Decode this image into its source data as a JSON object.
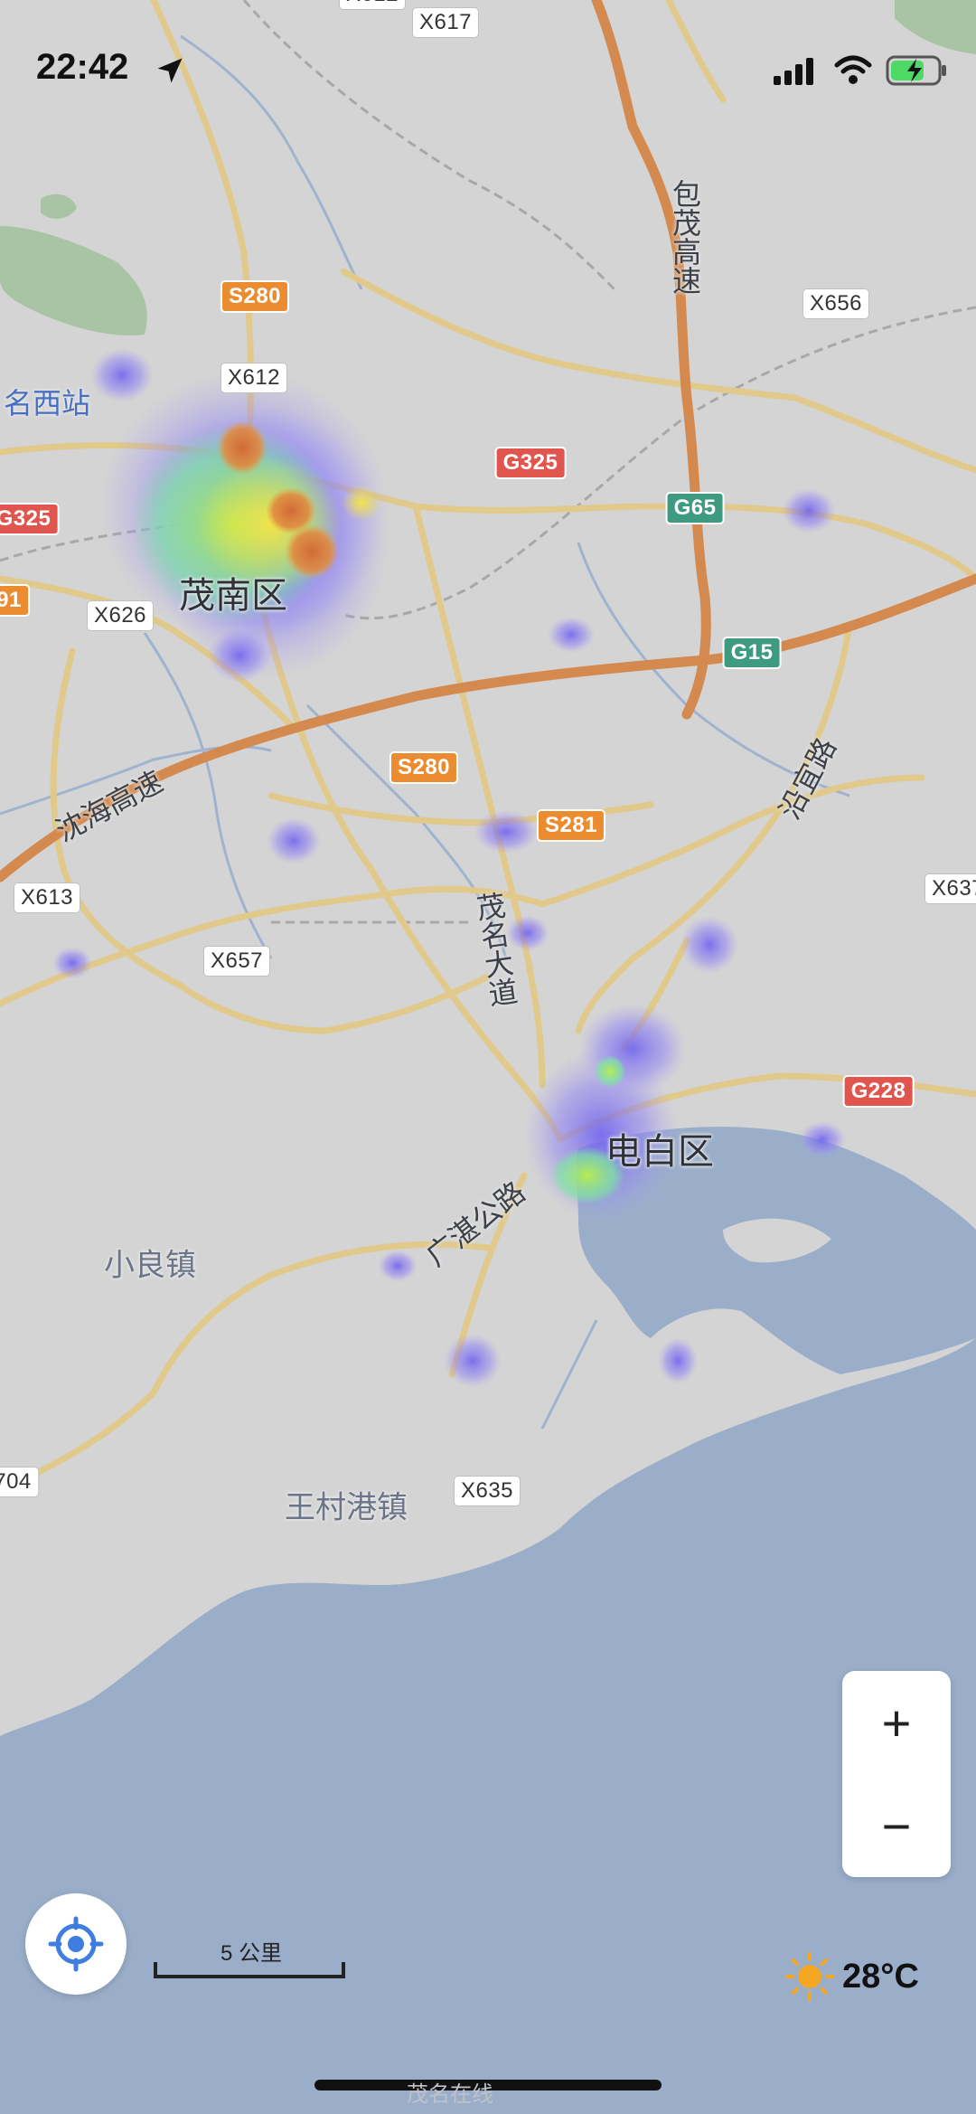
{
  "status_bar": {
    "time": "22:42"
  },
  "map": {
    "places": [
      {
        "id": "maonan",
        "text": "茂南区",
        "cls": "big"
      },
      {
        "id": "dianbai",
        "text": "电白区",
        "cls": "big"
      },
      {
        "id": "xiaoliang",
        "text": "小良镇",
        "cls": "light"
      },
      {
        "id": "wangcun",
        "text": "王村港镇",
        "cls": "light"
      },
      {
        "id": "station",
        "text": "名西站",
        "cls": "station"
      }
    ],
    "road_names": [
      {
        "id": "baomao",
        "text": "包茂高速"
      },
      {
        "id": "shenhai",
        "text": "沈海高速"
      },
      {
        "id": "maoming",
        "text": "茂名大道"
      },
      {
        "id": "guangzhan",
        "text": "广湛公路"
      },
      {
        "id": "yanyi",
        "text": "沿宜路"
      }
    ],
    "shields": [
      {
        "id": "x617",
        "text": "X617",
        "type": "county"
      },
      {
        "id": "x612top",
        "text": "X612",
        "type": "county"
      },
      {
        "id": "s280a",
        "text": "S280",
        "type": "provincial"
      },
      {
        "id": "x656",
        "text": "X656",
        "type": "county"
      },
      {
        "id": "x612",
        "text": "X612",
        "type": "county"
      },
      {
        "id": "g325a",
        "text": "G325",
        "type": "national"
      },
      {
        "id": "g325b",
        "text": "G325",
        "type": "national"
      },
      {
        "id": "g65",
        "text": "G65",
        "type": "expressway"
      },
      {
        "id": "s91",
        "text": "91",
        "type": "provincial"
      },
      {
        "id": "x626",
        "text": "X626",
        "type": "county"
      },
      {
        "id": "g15",
        "text": "G15",
        "type": "expressway"
      },
      {
        "id": "s280b",
        "text": "S280",
        "type": "provincial"
      },
      {
        "id": "s281",
        "text": "S281",
        "type": "provincial"
      },
      {
        "id": "x613",
        "text": "X613",
        "type": "county"
      },
      {
        "id": "x637",
        "text": "X637",
        "type": "county"
      },
      {
        "id": "x657",
        "text": "X657",
        "type": "county"
      },
      {
        "id": "g228",
        "text": "G228",
        "type": "national"
      },
      {
        "id": "x704",
        "text": "704",
        "type": "county"
      },
      {
        "id": "x635",
        "text": "X635",
        "type": "county"
      }
    ],
    "colors": {
      "land": "#d4d4d4",
      "water": "#9aaeca",
      "highway": "#d48a4e",
      "road": "#e0c98a",
      "rail": "#a0a0a0"
    }
  },
  "controls": {
    "zoom_in": "+",
    "zoom_out": "−",
    "scale_label": "5 公里",
    "temperature": "28°C"
  },
  "watermark": "茂名在线"
}
